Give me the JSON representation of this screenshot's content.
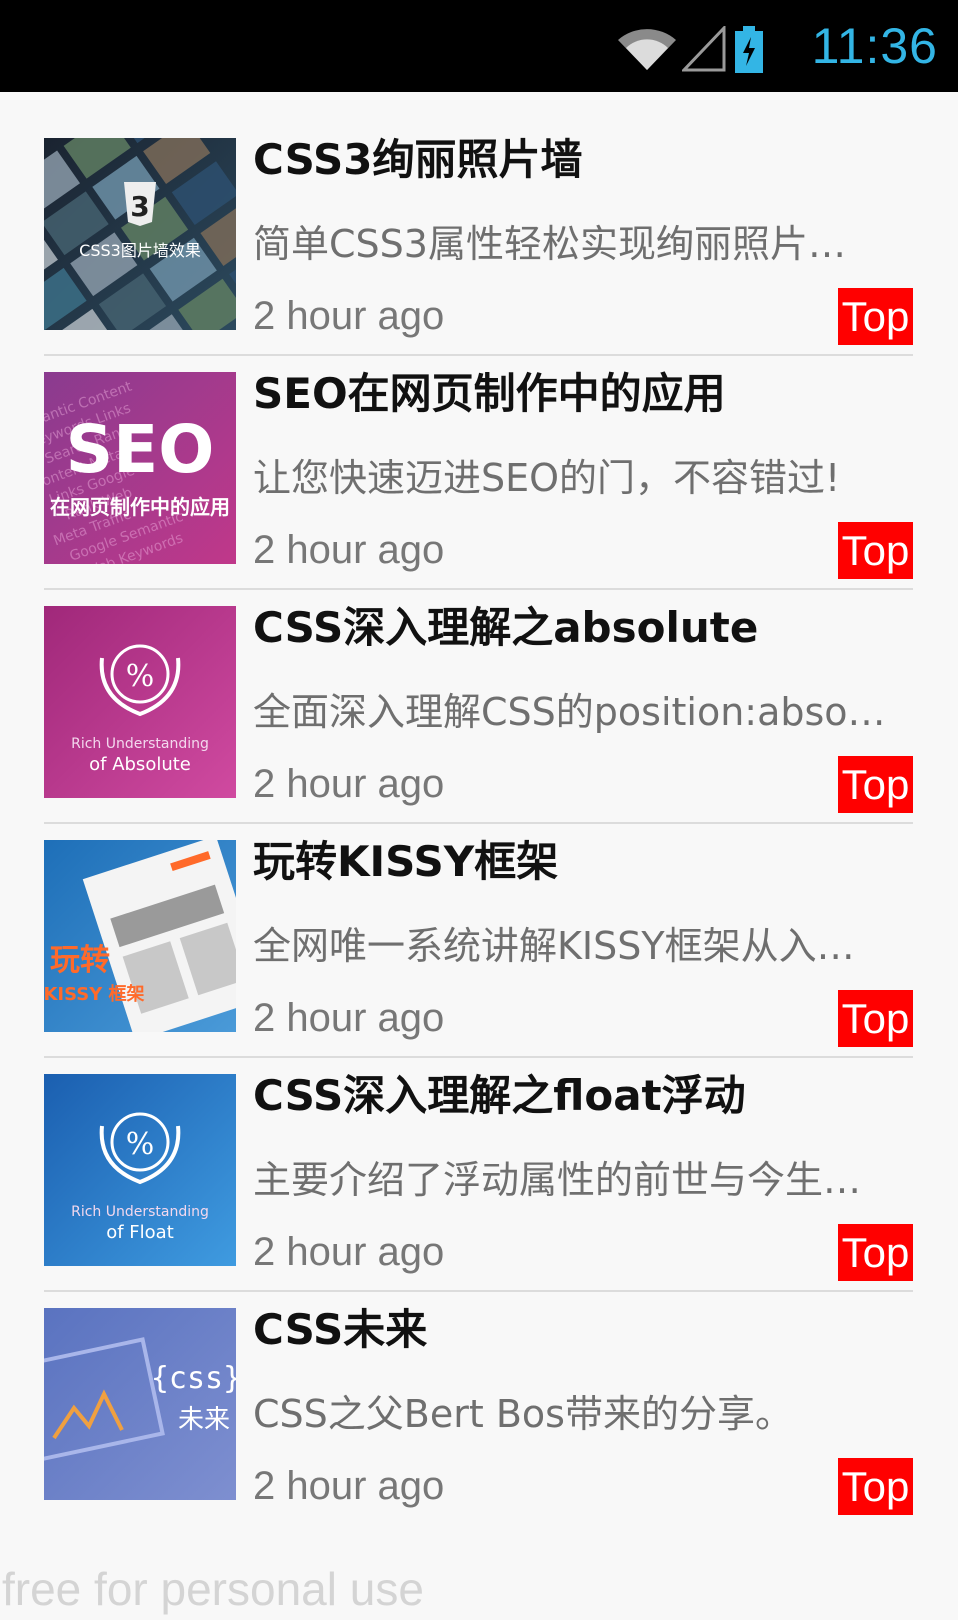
{
  "status_bar": {
    "time": "11:36",
    "icons": [
      "wifi-icon",
      "signal-icon",
      "battery-charging-icon"
    ],
    "accent_color": "#33b5e5"
  },
  "items": [
    {
      "title": "CSS3绚丽照片墙",
      "desc": "简单CSS3属性轻松实现绚丽照片…",
      "time": "2 hour ago",
      "badge": "Top",
      "thumb": {
        "theme": "photo-wall",
        "lines": [
          "CSS3图片墙效果"
        ],
        "colors": [
          "#1a2330",
          "#2c4a5e"
        ]
      }
    },
    {
      "title": "SEO在网页制作中的应用",
      "desc": "让您快速迈进SEO的门，不容错过!",
      "time": "2 hour ago",
      "badge": "Top",
      "thumb": {
        "theme": "seo",
        "lines": [
          "SEO",
          "在网页制作中的应用"
        ],
        "colors": [
          "#8a3b8f",
          "#c0388a"
        ]
      }
    },
    {
      "title": "CSS深入理解之absolute",
      "desc": "全面深入理解CSS的position:abso…",
      "time": "2 hour ago",
      "badge": "Top",
      "thumb": {
        "theme": "laurel",
        "lines": [
          "Rich Understanding",
          "of Absolute"
        ],
        "colors": [
          "#a0287a",
          "#d04aa0"
        ]
      }
    },
    {
      "title": "玩转KISSY框架",
      "desc": "全网唯一系统讲解KISSY框架从入…",
      "time": "2 hour ago",
      "badge": "Top",
      "thumb": {
        "theme": "kissy",
        "lines": [
          "玩转",
          "KISSY 框架"
        ],
        "colors": [
          "#1e6fb8",
          "#4a9ad8"
        ]
      }
    },
    {
      "title": "CSS深入理解之float浮动",
      "desc": "主要介绍了浮动属性的前世与今生…",
      "time": "2 hour ago",
      "badge": "Top",
      "thumb": {
        "theme": "laurel",
        "lines": [
          "Rich Understanding",
          "of Float"
        ],
        "colors": [
          "#1b5fb0",
          "#3f9be0"
        ]
      }
    },
    {
      "title": "CSS未来",
      "desc": "CSS之父Bert Bos带来的分享。",
      "time": "2 hour ago",
      "badge": "Top",
      "thumb": {
        "theme": "css-future",
        "lines": [
          "{css}",
          "未来"
        ],
        "colors": [
          "#5a73c0",
          "#7e8fd0"
        ]
      }
    }
  ],
  "watermark": "free for personal use"
}
